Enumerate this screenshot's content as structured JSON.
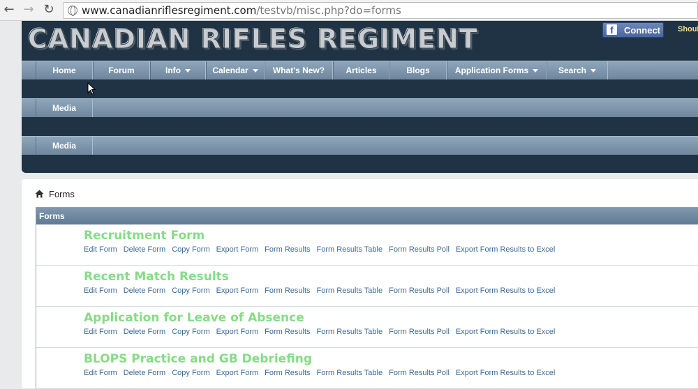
{
  "browser": {
    "url_host": "www.canadianriflesregiment.com",
    "url_path": "/testvb/misc.php?do=forms"
  },
  "header": {
    "logo_text": "CANADIAN RIFLES REGIMENT",
    "fb_connect_label": "Connect",
    "should_text": "Shoul"
  },
  "nav": {
    "row1": [
      {
        "label": "Home",
        "dropdown": false
      },
      {
        "label": "Forum",
        "dropdown": false
      },
      {
        "label": "Info",
        "dropdown": true
      },
      {
        "label": "Calendar",
        "dropdown": true
      },
      {
        "label": "What's New?",
        "dropdown": false
      },
      {
        "label": "Articles",
        "dropdown": false
      },
      {
        "label": "Blogs",
        "dropdown": false
      },
      {
        "label": "Application Forms",
        "dropdown": true
      },
      {
        "label": "Search",
        "dropdown": true
      }
    ],
    "row2": [
      {
        "label": "Media"
      }
    ],
    "row3": [
      {
        "label": "Media"
      }
    ]
  },
  "breadcrumb": {
    "label": "Forms"
  },
  "panel": {
    "title": "Forms",
    "forms": [
      {
        "title": "Recruitment Form"
      },
      {
        "title": "Recent Match Results"
      },
      {
        "title": "Application for Leave of Absence"
      },
      {
        "title": "BLOPS Practice and GB Debriefing"
      }
    ],
    "actions": [
      "Edit Form",
      "Delete Form",
      "Copy Form",
      "Export Form",
      "Form Results",
      "Form Results Table",
      "Form Results Poll",
      "Export Form Results to Excel"
    ]
  },
  "colors": {
    "header_bg": "#1f3345",
    "nav_bg": "#7f98ae",
    "form_title": "#86dc86",
    "link": "#3e6a93"
  }
}
